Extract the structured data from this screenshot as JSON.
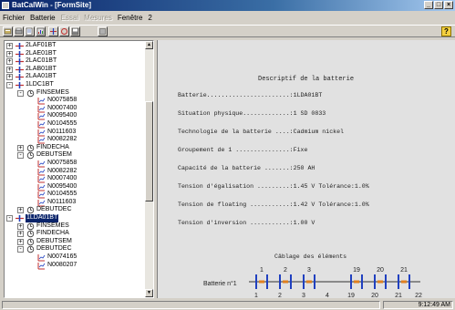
{
  "window": {
    "title": "BatCalWin - [FormSite]"
  },
  "menu": [
    {
      "label": "Fichier",
      "enabled": true
    },
    {
      "label": "Batterie",
      "enabled": true
    },
    {
      "label": "Essai",
      "enabled": false
    },
    {
      "label": "Mesures",
      "enabled": false
    },
    {
      "label": "Fenêtre",
      "enabled": true
    },
    {
      "label": "2",
      "enabled": true
    }
  ],
  "toolbar": {
    "buttons": [
      "open-icon",
      "print-icon",
      "edit-icon",
      "report-icon",
      "battery-icon",
      "refresh-icon",
      "disk-icon",
      "stop-icon"
    ],
    "help_label": "?"
  },
  "tree": [
    {
      "label": "2LAF01BT",
      "level": 0,
      "type": "battery",
      "expander": "+"
    },
    {
      "label": "2LAE01BT",
      "level": 0,
      "type": "battery",
      "expander": "+"
    },
    {
      "label": "2LAC01BT",
      "level": 0,
      "type": "battery",
      "expander": "+"
    },
    {
      "label": "2LAB01BT",
      "level": 0,
      "type": "battery",
      "expander": "+"
    },
    {
      "label": "2LAA01BT",
      "level": 0,
      "type": "battery",
      "expander": "+"
    },
    {
      "label": "1LDC1BT",
      "level": 0,
      "type": "battery",
      "expander": "-"
    },
    {
      "label": "FINSEMES",
      "level": 1,
      "type": "test",
      "expander": "-"
    },
    {
      "label": "N0075858",
      "level": 2,
      "type": "measure",
      "expander": ""
    },
    {
      "label": "N0007400",
      "level": 2,
      "type": "measure",
      "expander": ""
    },
    {
      "label": "N0095400",
      "level": 2,
      "type": "measure",
      "expander": ""
    },
    {
      "label": "N0104555",
      "level": 2,
      "type": "measure",
      "expander": ""
    },
    {
      "label": "N0111603",
      "level": 2,
      "type": "measure",
      "expander": ""
    },
    {
      "label": "N0082282",
      "level": 2,
      "type": "measure",
      "expander": ""
    },
    {
      "label": "FINDECHA",
      "level": 1,
      "type": "test",
      "expander": "+"
    },
    {
      "label": "DEBUTSEM",
      "level": 1,
      "type": "test",
      "expander": "-"
    },
    {
      "label": "N0075858",
      "level": 2,
      "type": "measure",
      "expander": ""
    },
    {
      "label": "N0082282",
      "level": 2,
      "type": "measure",
      "expander": ""
    },
    {
      "label": "N0007400",
      "level": 2,
      "type": "measure",
      "expander": ""
    },
    {
      "label": "N0095400",
      "level": 2,
      "type": "measure",
      "expander": ""
    },
    {
      "label": "N0104555",
      "level": 2,
      "type": "measure",
      "expander": ""
    },
    {
      "label": "N0111603",
      "level": 2,
      "type": "measure",
      "expander": ""
    },
    {
      "label": "DEBUTDEC",
      "level": 1,
      "type": "test",
      "expander": "+"
    },
    {
      "label": "1LDA01BT",
      "level": 0,
      "type": "battery",
      "expander": "-",
      "selected": true
    },
    {
      "label": "FINSEMES",
      "level": 1,
      "type": "test",
      "expander": "+"
    },
    {
      "label": "FINDECHA",
      "level": 1,
      "type": "test",
      "expander": "+"
    },
    {
      "label": "DEBUTSEM",
      "level": 1,
      "type": "test",
      "expander": "+"
    },
    {
      "label": "DEBUTDEC",
      "level": 1,
      "type": "test",
      "expander": "-"
    },
    {
      "label": "N0074165",
      "level": 2,
      "type": "measure",
      "expander": ""
    },
    {
      "label": "N0080207",
      "level": 2,
      "type": "measure",
      "expander": ""
    }
  ],
  "document": {
    "title": "Descriptif de la batterie",
    "lines": [
      "Batterie.......................:1LDA01BT",
      "Situation physique.............:1 SD 0833",
      "Technologie de la batterie ....:Cadmium nickel",
      "Groupement de 1 ...............:Fixe",
      "Capacité de la batterie .......:250 AH",
      "Tension d'égalisation .........:1.45 V Tolérance:1.0%",
      "Tension de floating ...........:1.42 V Tolérance:1.0%",
      "Tension d'inversion ...........:1.00 V"
    ],
    "cabling_title": "Câblage des éléments",
    "battery_label": "Batterie n°1",
    "top_numbers": [
      "1",
      "2",
      "3",
      "19",
      "20",
      "21"
    ],
    "bottom_numbers": [
      "1",
      "2",
      "3",
      "4",
      "19",
      "20",
      "21",
      "22"
    ]
  },
  "status": {
    "message": "",
    "time": "9:12:49 AM"
  }
}
